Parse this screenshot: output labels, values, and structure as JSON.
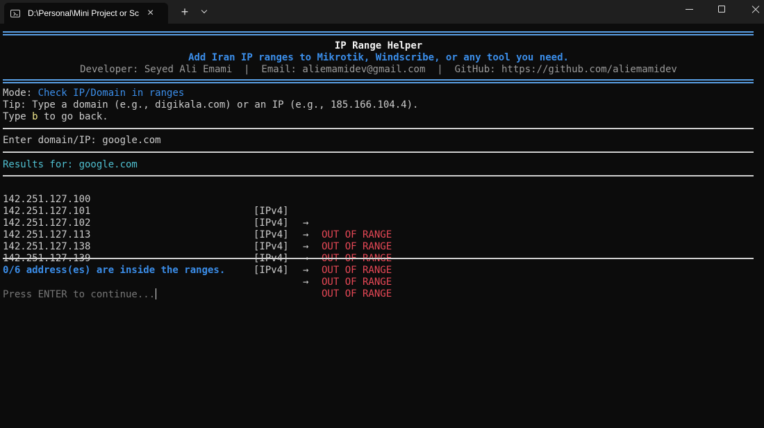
{
  "window": {
    "tab_title": "D:\\Personal\\Mini Project or Sc",
    "tab_close": "×",
    "new_tab": "+",
    "icons": [
      "terminal-icon",
      "close-icon",
      "plus-icon",
      "chevron-down-icon",
      "minimize-icon",
      "maximize-icon",
      "window-close-icon"
    ]
  },
  "header": {
    "title": "IP Range Helper",
    "subtitle": "Add Iran IP ranges to Mikrotik, Windscribe, or any tool you need.",
    "credits": "Developer: Seyed Ali Emami  |  Email: aliemamidev@gmail.com  |  GitHub: https://github.com/aliemamidev"
  },
  "mode": {
    "label": "Mode: ",
    "value": "Check IP/Domain in ranges",
    "tip": "Tip: Type a domain (e.g., digikala.com) or an IP (e.g., 185.166.104.4).",
    "back_prefix": "Type ",
    "back_key": "b",
    "back_suffix": " to go back."
  },
  "prompt": {
    "label": "Enter domain/IP: ",
    "value": "google.com"
  },
  "results": {
    "label": "Results for: ",
    "query": "google.com",
    "arrow": "→",
    "rows": [
      {
        "ip": "142.251.127.100",
        "type": "[IPv4]",
        "status": "OUT OF RANGE"
      },
      {
        "ip": "142.251.127.101",
        "type": "[IPv4]",
        "status": "OUT OF RANGE"
      },
      {
        "ip": "142.251.127.102",
        "type": "[IPv4]",
        "status": "OUT OF RANGE"
      },
      {
        "ip": "142.251.127.113",
        "type": "[IPv4]",
        "status": "OUT OF RANGE"
      },
      {
        "ip": "142.251.127.138",
        "type": "[IPv4]",
        "status": "OUT OF RANGE"
      },
      {
        "ip": "142.251.127.139",
        "type": "[IPv4]",
        "status": "OUT OF RANGE"
      }
    ],
    "summary": "0/6 address(es) are inside the ranges."
  },
  "continue_text": "Press ENTER to continue...",
  "colors": {
    "accent_blue": "#3b8eea",
    "rule_blue": "#5aa0e6",
    "out_of_range": "#e74856",
    "results_cyan": "#4fbfd0"
  }
}
